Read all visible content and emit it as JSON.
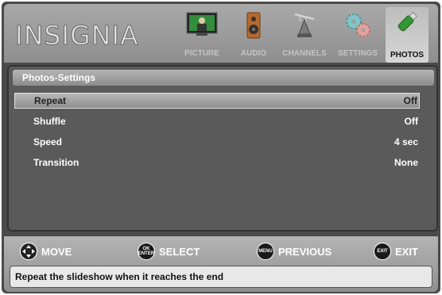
{
  "brand": {
    "logo_text": "INSIGNIA"
  },
  "menu": {
    "tabs": [
      {
        "label": "PICTURE",
        "icon": "picture-icon",
        "active": false
      },
      {
        "label": "AUDIO",
        "icon": "speaker-icon",
        "active": false
      },
      {
        "label": "CHANNELS",
        "icon": "antenna-icon",
        "active": false
      },
      {
        "label": "SETTINGS",
        "icon": "gears-icon",
        "active": false
      },
      {
        "label": "PHOTOS",
        "icon": "usb-stick-icon",
        "active": true
      }
    ]
  },
  "panel": {
    "title": "Photos-Settings",
    "rows": [
      {
        "name": "Repeat",
        "value": "Off",
        "selected": true
      },
      {
        "name": "Shuffle",
        "value": "Off",
        "selected": false
      },
      {
        "name": "Speed",
        "value": "4 sec",
        "selected": false
      },
      {
        "name": "Transition",
        "value": "None",
        "selected": false
      }
    ]
  },
  "footer": {
    "controls": [
      {
        "label": "MOVE",
        "button_icon": "dpad-icon",
        "button_text": ""
      },
      {
        "label": "SELECT",
        "button_icon": "ok-enter-icon",
        "button_text": "OK ENTER"
      },
      {
        "label": "PREVIOUS",
        "button_icon": "menu-button-icon",
        "button_text": "MENU"
      },
      {
        "label": "EXIT",
        "button_icon": "exit-button-icon",
        "button_text": "EXIT"
      }
    ],
    "hint": "Repeat the slideshow when it reaches the end"
  },
  "colors": {
    "header_bg": "#9a9a9a",
    "panel_bg": "#5a5a5a",
    "highlight_bg": "#a8a8a8",
    "text_light": "#ffffff"
  }
}
